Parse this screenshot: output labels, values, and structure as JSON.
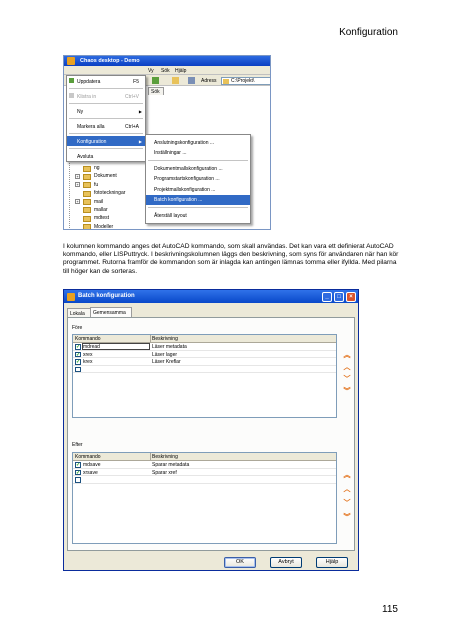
{
  "page": {
    "header": "Konfiguration",
    "page_number": "115"
  },
  "screenshot1": {
    "title": "Chaos desktop - Demo",
    "menubar": [
      "Vy",
      "Sök",
      "Hjälp"
    ],
    "address_label": "Adress",
    "address_value": "C:\\Projekt\\",
    "tab_label": "Sök",
    "context_menu": [
      {
        "label": "Uppdatera",
        "shortcut": "F5",
        "state": "normal"
      },
      {
        "label": "Klistra in",
        "shortcut": "Ctrl+V",
        "state": "disabled"
      },
      {
        "label": "Ny",
        "shortcut": "",
        "state": "submenu"
      },
      {
        "label": "Markera alla",
        "shortcut": "Ctrl+A",
        "state": "normal"
      },
      {
        "label": "Konfiguration",
        "shortcut": "",
        "state": "highlighted"
      },
      {
        "label": "Avsluta",
        "shortcut": "",
        "state": "normal"
      }
    ],
    "submenu": [
      "Anslutningskonfiguration ...",
      "Inställningar ...",
      "Dokumentmallskonfiguration ...",
      "Programstartskonfiguration ...",
      "Projektmallskonfiguration ...",
      "Batch konfiguration ...",
      "Återställ layout"
    ],
    "submenu_highlighted_index": 5,
    "tree_items": [
      "ng",
      "Dokument",
      "fu",
      "fototeckningar",
      "mail",
      "mallar",
      "mdtest",
      "Modeller"
    ]
  },
  "paragraph": "I kolumnen kommando anges det AutoCAD kommando, som skall användas. Det kan vara ett definierat AutoCAD kommando, eller LISPuttryck. I beskrivningskolumnen läggs den beskrivning, som syns för användaren när han kör programmet. Rutorna framför de kommandon som är inlagda kan antingen lämnas tomma eller ifyllda. Med pilarna till höger kan de sorteras.",
  "dialog": {
    "title": "Batch konfiguration",
    "tabs": [
      "Lokala",
      "Gemensamma"
    ],
    "active_tab": "Gemensamma",
    "before_section": {
      "label": "Före",
      "col_command": "Kommando",
      "col_description": "Beskrivning",
      "rows": [
        {
          "checked": true,
          "command": "mdread",
          "description": "Läser metadata"
        },
        {
          "checked": true,
          "command": "xrex",
          "description": "Läser lager"
        },
        {
          "checked": true,
          "command": "krex",
          "description": "Läser Kreflar"
        },
        {
          "checked": false,
          "command": "",
          "description": ""
        }
      ]
    },
    "after_section": {
      "label": "Efter",
      "col_command": "Kommando",
      "col_description": "Beskrivning",
      "rows": [
        {
          "checked": true,
          "command": "mdsave",
          "description": "Sparar metadata"
        },
        {
          "checked": true,
          "command": "xrsave",
          "description": "Sparar xref"
        },
        {
          "checked": false,
          "command": "",
          "description": ""
        }
      ]
    },
    "buttons": {
      "ok": "OK",
      "cancel": "Avbryt",
      "help": "Hjälp"
    }
  }
}
